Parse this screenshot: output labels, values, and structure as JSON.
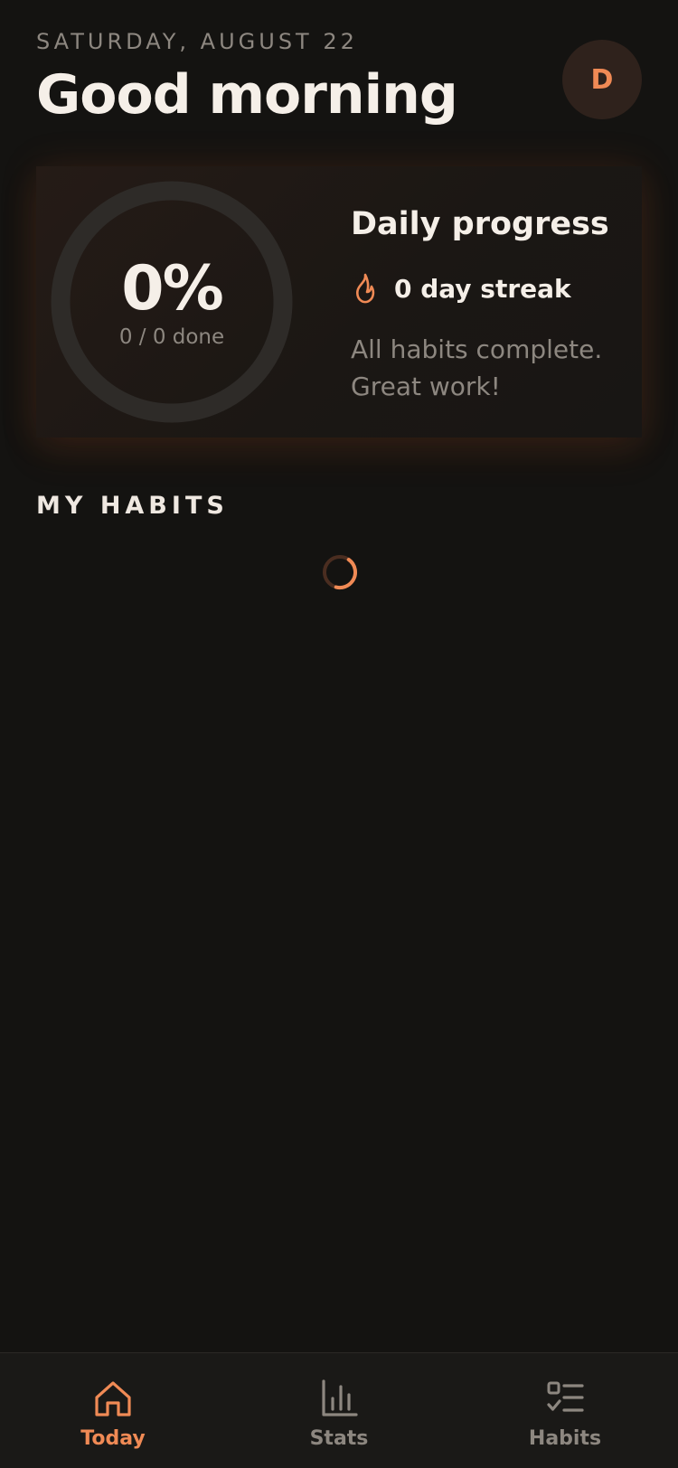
{
  "header": {
    "date": "SATURDAY, AUGUST 22",
    "greeting": "Good morning",
    "avatar_initial": "D"
  },
  "progress_card": {
    "percent_text": "0%",
    "percent_value": 0,
    "done_text": "0 / 0 done",
    "title": "Daily progress",
    "streak_text": "0 day streak",
    "message": "All habits complete. Great work!",
    "streak_icon": "flame-icon"
  },
  "habits": {
    "section_title": "MY HABITS",
    "loading_icon": "spinner-icon"
  },
  "bottom_nav": {
    "items": [
      {
        "label": "Today",
        "icon": "home-icon",
        "active": true
      },
      {
        "label": "Stats",
        "icon": "bar-chart-icon",
        "active": false
      },
      {
        "label": "Habits",
        "icon": "checklist-icon",
        "active": false
      }
    ]
  },
  "colors": {
    "background": "#141311",
    "accent": "#f08a55",
    "muted_text": "#8d8780",
    "primary_text": "#f5efe8",
    "ring_track": "#2e2b28"
  }
}
